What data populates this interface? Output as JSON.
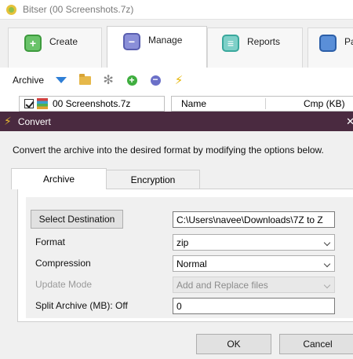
{
  "main_window": {
    "title": "Bitser (00 Screenshots.7z)",
    "ribbon_tabs": [
      {
        "label": "Create",
        "icon": "plus-square-icon",
        "color": "#5cb85c"
      },
      {
        "label": "Manage",
        "icon": "minus-square-icon",
        "color": "#7b80d0"
      },
      {
        "label": "Reports",
        "icon": "report-icon",
        "color": "#5bc4b8"
      },
      {
        "label": "Pa",
        "icon": "key-icon",
        "color": "#4a80d0"
      }
    ],
    "toolbar": {
      "label": "Archive",
      "icons": [
        "dropdown-arrow-icon",
        "folder-icon",
        "gear-icon",
        "add-icon",
        "remove-icon",
        "convert-bolt-icon"
      ]
    },
    "tree": {
      "item_label": "00 Screenshots.7z",
      "checked": true
    },
    "grid": {
      "columns": [
        "Name",
        "Cmp (KB)"
      ]
    }
  },
  "dialog": {
    "title": "Convert",
    "title_bar_color": "#4a2a40",
    "description": "Convert the archive into the desired format by modifying the options below.",
    "tabs": [
      {
        "label": "Archive",
        "active": true
      },
      {
        "label": "Encryption",
        "active": false
      }
    ],
    "fields": {
      "destination_button": "Select Destination",
      "destination_value": "C:\\Users\\navee\\Downloads\\7Z to Z",
      "format_label": "Format",
      "format_value": "zip",
      "compression_label": "Compression",
      "compression_value": "Normal",
      "update_mode_label": "Update Mode",
      "update_mode_value": "Add and Replace files",
      "update_mode_enabled": false,
      "split_label": "Split Archive (MB): Off",
      "split_value": "0"
    },
    "buttons": {
      "ok": "OK",
      "cancel": "Cancel"
    }
  }
}
